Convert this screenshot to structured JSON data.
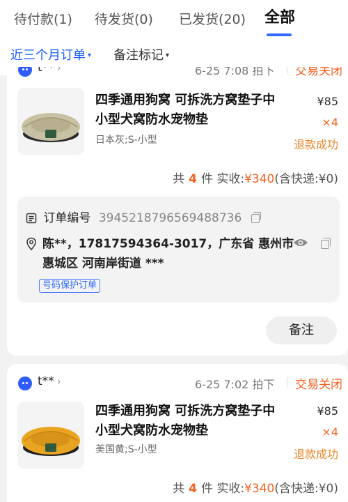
{
  "tabs": [
    {
      "label": "待付款(1)"
    },
    {
      "label": "待发货(0)"
    },
    {
      "label": "已发货(20)"
    },
    {
      "label": "全部"
    }
  ],
  "filters": {
    "time_range": "近三个月订单",
    "remark_flag": "备注标记"
  },
  "orders": [
    {
      "shop": "t**",
      "time": "6-25 7:08 拍下",
      "status": "交易关闭",
      "product_title": "四季通用狗窝 可拆洗方窝垫子中小型犬窝防水宠物垫",
      "spec": "日本灰;S-小型",
      "price": "¥85",
      "quantity": "×4",
      "refund": "退款成功",
      "total_prefix": "共",
      "total_count": "4",
      "total_suffix": "件  实收:",
      "total_amount": "¥340",
      "shipping": "(含快递:¥0)",
      "order_no_label": "订单编号",
      "order_no": "3945218796569488736",
      "address": "陈**，17817594364-3017，广东省 惠州市 惠城区 河南岸街道 ***",
      "privacy_tag": "号码保护订单",
      "remark_button": "备注"
    },
    {
      "shop": "t**",
      "time": "6-25 7:02 拍下",
      "status": "交易关闭",
      "product_title": "四季通用狗窝 可拆洗方窝垫子中小型犬窝防水宠物垫",
      "spec": "美国黄;S-小型",
      "price": "¥85",
      "quantity": "×4",
      "refund": "退款成功",
      "total_prefix": "共",
      "total_count": "4",
      "total_suffix": "件  实收:",
      "total_amount": "¥340",
      "shipping": "(含快递:¥0)"
    }
  ],
  "colors": {
    "accent_blue": "#2f6bff",
    "status_orange": "#f5601e",
    "refund_orange": "#e8872b",
    "bed_gray": "#c9c1a3",
    "bed_yellow": "#e9a521"
  }
}
